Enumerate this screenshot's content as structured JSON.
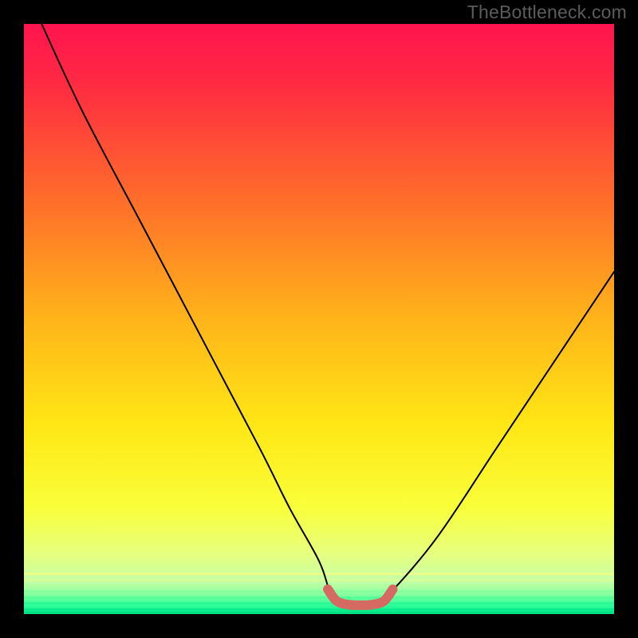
{
  "watermark": {
    "text": "TheBottleneck.com"
  },
  "chart_data": {
    "type": "line",
    "title": "",
    "xlabel": "",
    "ylabel": "",
    "xlim": [
      0,
      100
    ],
    "ylim": [
      0,
      100
    ],
    "series": [
      {
        "name": "bottleneck-curve",
        "x": [
          3,
          10,
          20,
          30,
          40,
          45,
          50,
          52,
          54,
          56,
          58,
          60,
          62,
          70,
          80,
          90,
          100
        ],
        "values": [
          100,
          85,
          66,
          47,
          28,
          18,
          9,
          3.5,
          2,
          1.5,
          1.5,
          2,
          3.5,
          13,
          28,
          43,
          58
        ]
      }
    ],
    "highlight": {
      "name": "optimal-zone",
      "x": [
        51.5,
        53,
        55,
        57,
        59,
        61,
        62.5
      ],
      "values": [
        4.2,
        2.2,
        1.6,
        1.5,
        1.6,
        2.2,
        4.2
      ]
    },
    "background_gradient": {
      "stops": [
        {
          "pos": 0.0,
          "color": "#ff1450"
        },
        {
          "pos": 0.1,
          "color": "#ff2a42"
        },
        {
          "pos": 0.3,
          "color": "#ff6e2a"
        },
        {
          "pos": 0.5,
          "color": "#ffb41a"
        },
        {
          "pos": 0.68,
          "color": "#ffe715"
        },
        {
          "pos": 0.82,
          "color": "#f9ff3a"
        },
        {
          "pos": 0.9,
          "color": "#e6ff80"
        },
        {
          "pos": 0.945,
          "color": "#c4ffa8"
        },
        {
          "pos": 0.965,
          "color": "#8effa0"
        },
        {
          "pos": 0.985,
          "color": "#2eff9a"
        },
        {
          "pos": 1.0,
          "color": "#00e888"
        }
      ]
    },
    "colors": {
      "curve": "#000000",
      "highlight": "#d46a62"
    }
  }
}
